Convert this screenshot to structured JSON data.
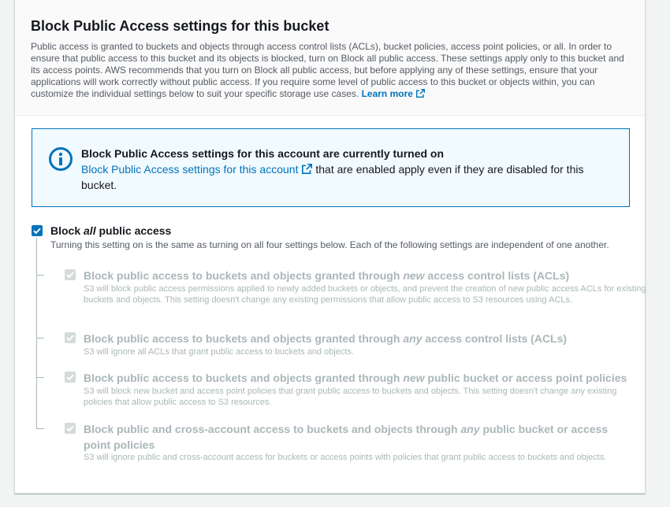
{
  "header": {
    "title": "Block Public Access settings for this bucket",
    "description": "Public access is granted to buckets and objects through access control lists (ACLs), bucket policies, access point policies, or all. In order to ensure that public access to this bucket and its objects is blocked, turn on Block all public access. These settings apply only to this bucket and its access points. AWS recommends that you turn on Block all public access, but before applying any of these settings, ensure that your applications will work correctly without public access. If you require some level of public access to this bucket or objects within, you can customize the individual settings below to suit your specific storage use cases.",
    "learn_more": "Learn more"
  },
  "info": {
    "title": "Block Public Access settings for this account are currently turned on",
    "link_text": "Block Public Access settings for this account",
    "rest_text": "that are enabled apply even if they are disabled for this bucket."
  },
  "block_all": {
    "label_pre": "Block ",
    "label_em": "all",
    "label_post": " public access",
    "description": "Turning this setting on is the same as turning on all four settings below. Each of the following settings are independent of one another.",
    "checked": true
  },
  "sub_options": [
    {
      "label_pre": "Block public access to buckets and objects granted through ",
      "label_em": "new",
      "label_post": " access control lists (ACLs)",
      "description": "S3 will block public access permissions applied to newly added buckets or objects, and prevent the creation of new public access ACLs for existing buckets and objects. This setting doesn't change any existing permissions that allow public access to S3 resources using ACLs.",
      "checked": true
    },
    {
      "label_pre": "Block public access to buckets and objects granted through ",
      "label_em": "any",
      "label_post": " access control lists (ACLs)",
      "description": "S3 will ignore all ACLs that grant public access to buckets and objects.",
      "checked": true
    },
    {
      "label_pre": "Block public access to buckets and objects granted through ",
      "label_em": "new",
      "label_post": " public bucket or access point policies",
      "description": "S3 will block new bucket and access point policies that grant public access to buckets and objects. This setting doesn't change any existing policies that allow public access to S3 resources.",
      "checked": true
    },
    {
      "label_pre": "Block public and cross-account access to buckets and objects through ",
      "label_em": "any",
      "label_post": " public bucket or access point policies",
      "description": "S3 will ignore public and cross-account access for buckets or access points with policies that grant public access to buckets and objects.",
      "checked": true
    }
  ],
  "colors": {
    "link": "#0073bb",
    "checkbox_active": "#0073bb",
    "checkbox_disabled": "#d5dbdb",
    "info_bg": "#f1faff"
  },
  "icons": {
    "info": "info-circle-icon",
    "external": "external-link-icon",
    "check": "checkmark-icon"
  }
}
